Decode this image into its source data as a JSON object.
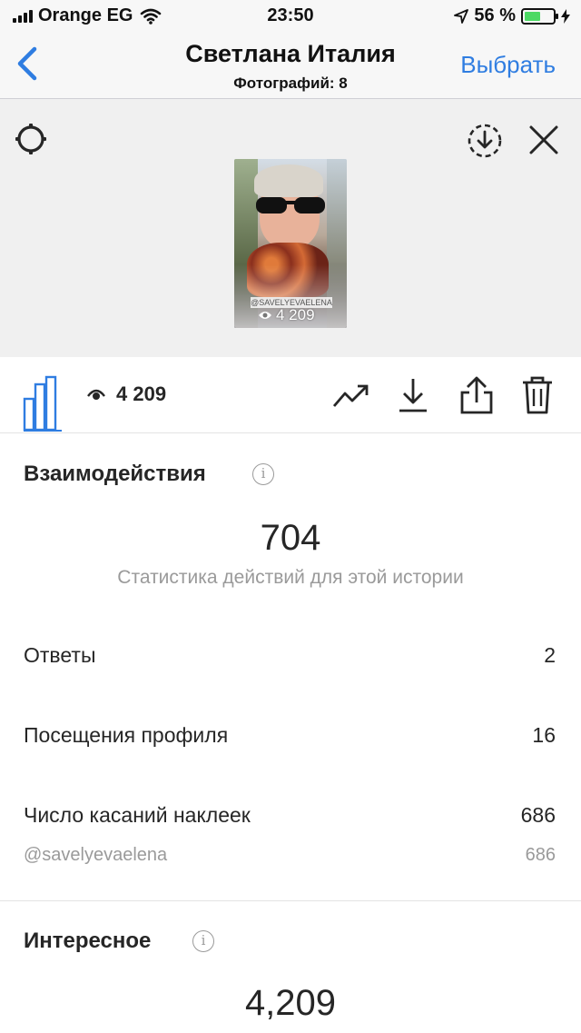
{
  "status_bar": {
    "carrier": "Orange EG",
    "time": "23:50",
    "battery_percent": "56 %",
    "battery_level": 0.56
  },
  "nav": {
    "back_icon": "chevron-left-icon",
    "title": "Светлана Италия",
    "subtitle": "Фотографий: 8",
    "select_label": "Выбрать",
    "accent_color": "#2f7de1"
  },
  "preview": {
    "thumbnail_tag": "@SAVELYEVAELENA",
    "thumbnail_views": "4 209",
    "icons": [
      "settings-gear-icon",
      "download-circle-icon",
      "close-icon"
    ]
  },
  "toolbar": {
    "views_count": "4 209",
    "icons": [
      "bar-chart-icon",
      "eye-icon",
      "trend-icon",
      "download-icon",
      "share-icon",
      "trash-icon"
    ]
  },
  "interactions": {
    "title": "Взаимодействия",
    "total": "704",
    "caption": "Статистика действий для этой истории",
    "rows": [
      {
        "label": "Ответы",
        "value": "2"
      },
      {
        "label": "Посещения профиля",
        "value": "16"
      },
      {
        "label": "Число касаний наклеек",
        "value": "686"
      }
    ],
    "sub_row": {
      "label": "@savelyevaelena",
      "value": "686"
    }
  },
  "discovery": {
    "title": "Интересное",
    "total": "4,209"
  }
}
